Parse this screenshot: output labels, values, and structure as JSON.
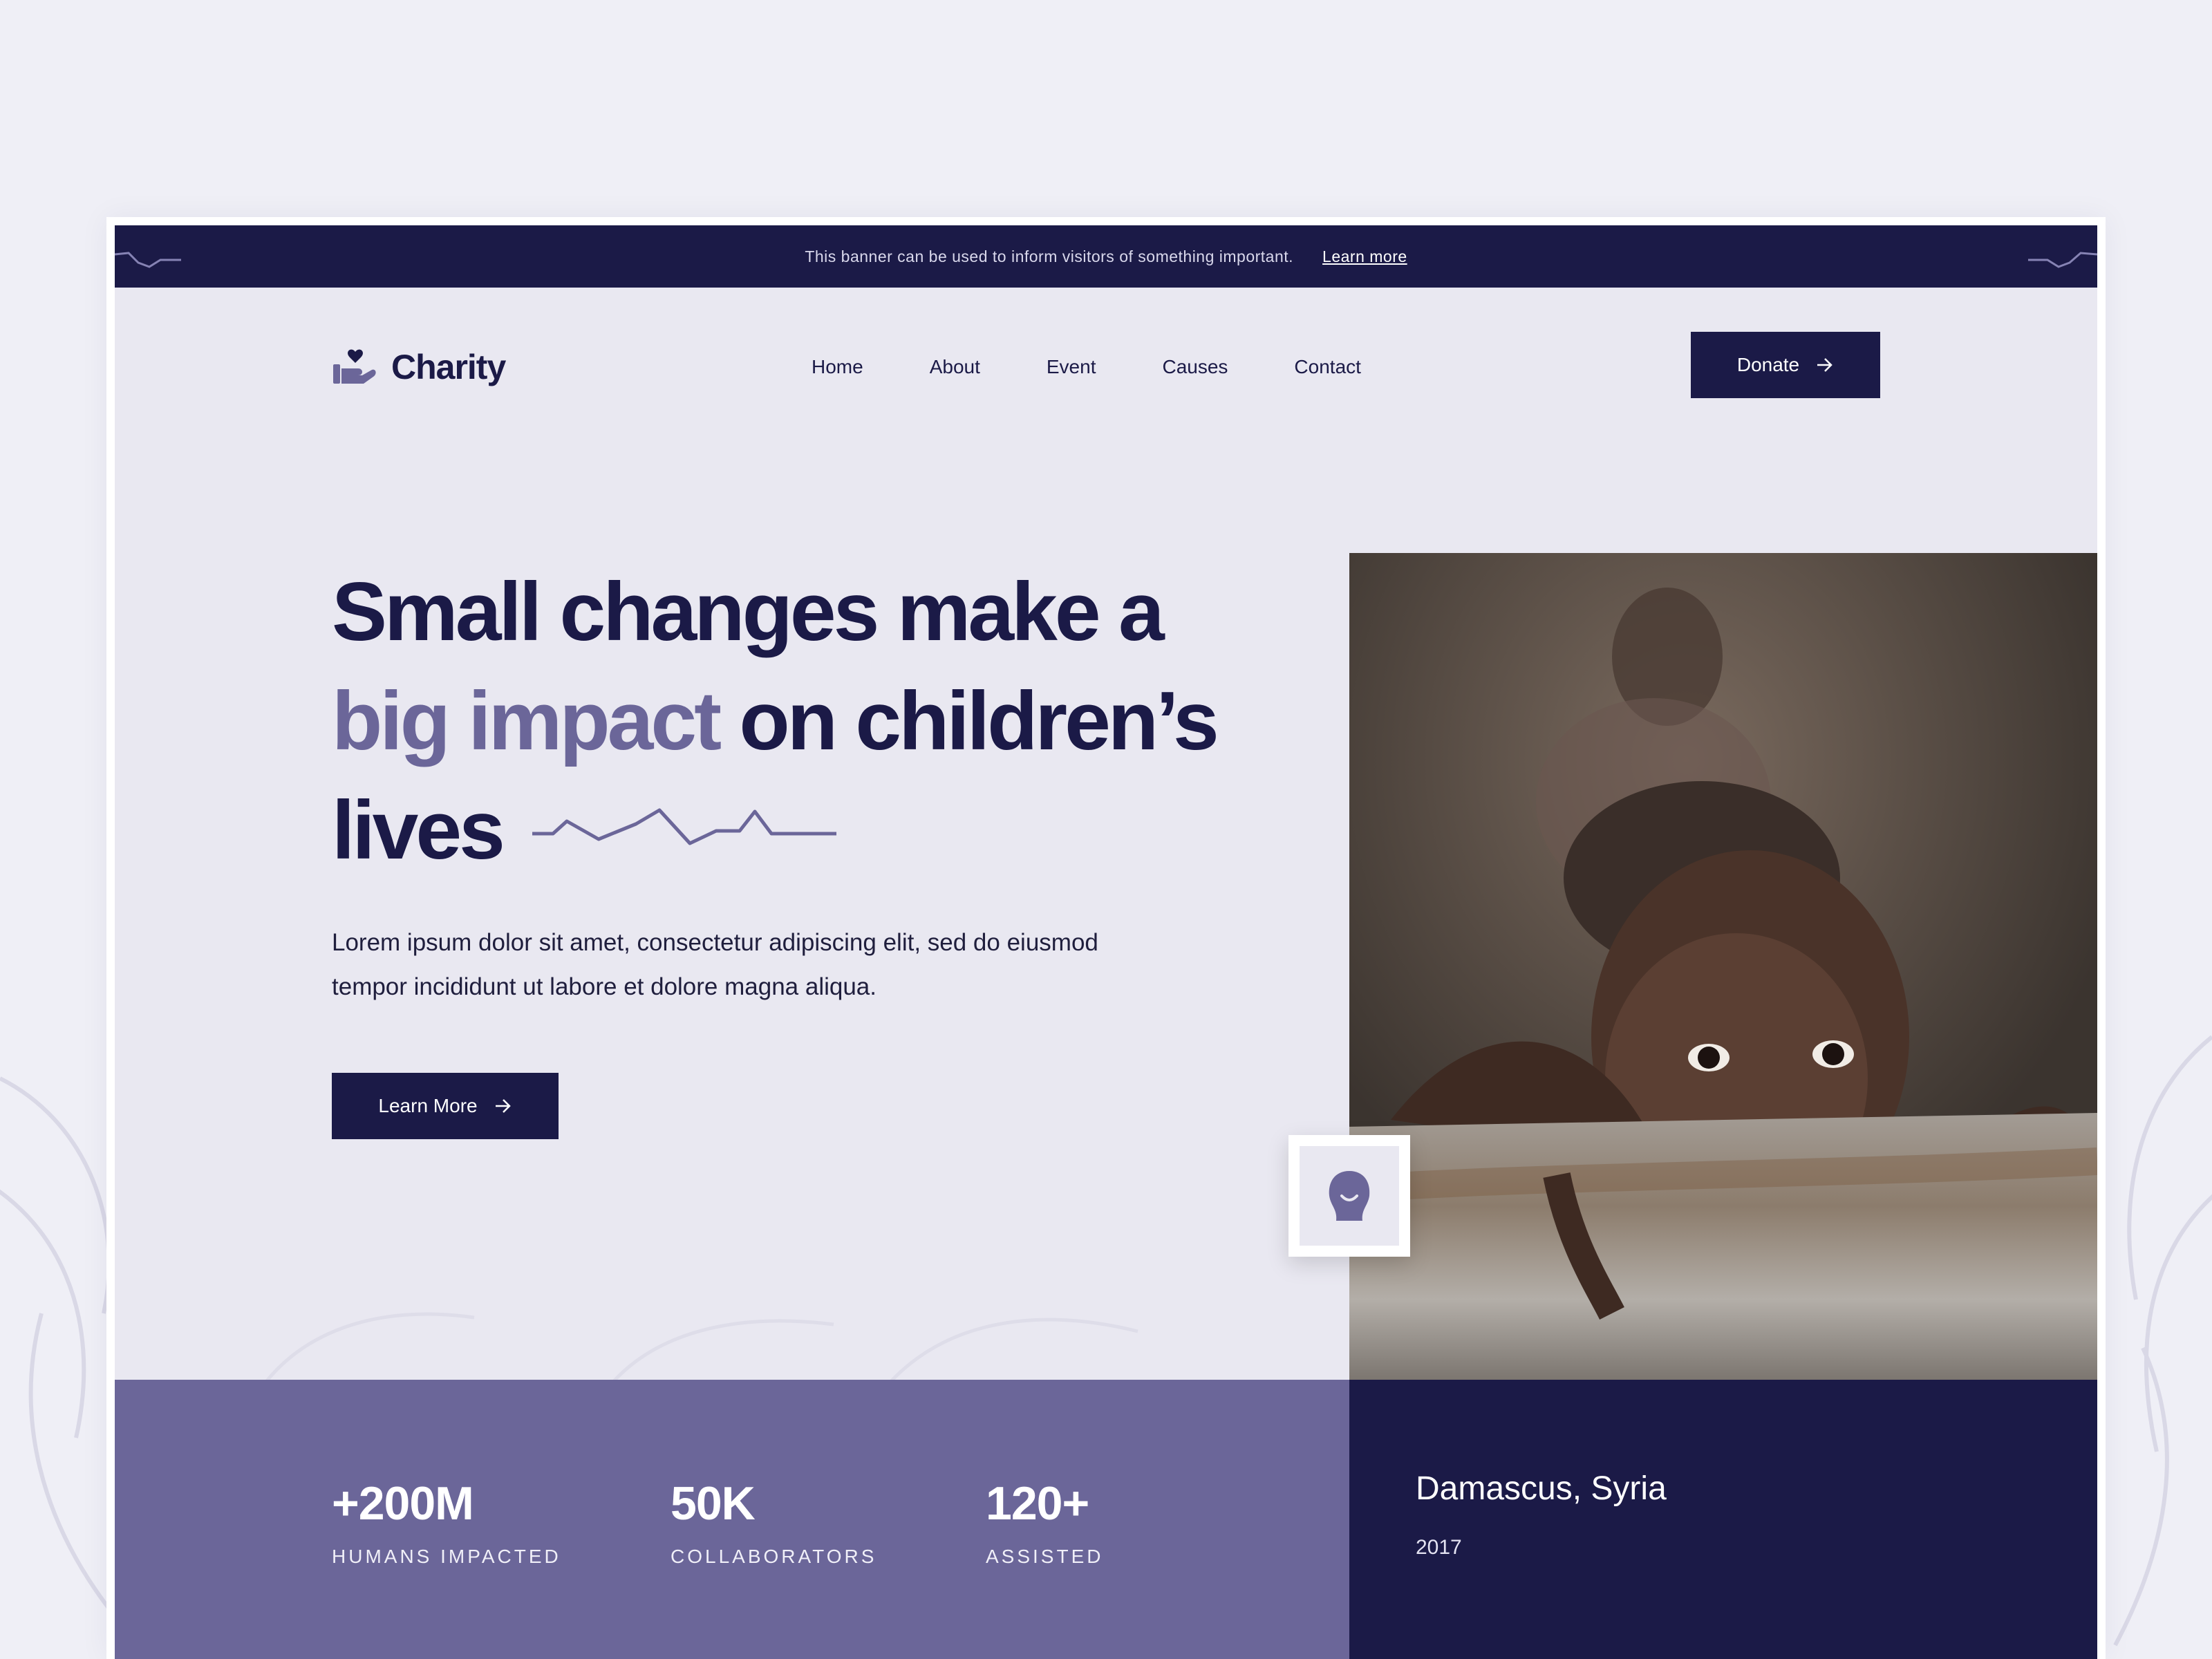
{
  "banner": {
    "message": "This banner can be used to inform visitors of something important.",
    "link_label": "Learn more"
  },
  "brand": {
    "name": "Charity"
  },
  "nav": {
    "items": [
      {
        "label": "Home"
      },
      {
        "label": "About"
      },
      {
        "label": "Event"
      },
      {
        "label": "Causes"
      },
      {
        "label": "Contact"
      }
    ],
    "donate_label": "Donate"
  },
  "hero": {
    "headline_part1": "Small changes make a",
    "headline_highlight": "big impact",
    "headline_part2": " on children’s",
    "headline_part3": "lives",
    "lead": "Lorem ipsum dolor sit amet, consectetur adipiscing elit, sed do eiusmod tempor incididunt ut labore et dolore magna aliqua.",
    "cta_label": "Learn More"
  },
  "stats": [
    {
      "value": "+200M",
      "label": "HUMANS IMPACTED"
    },
    {
      "value": "50K",
      "label": "COLLABORATORS"
    },
    {
      "value": "120+",
      "label": "ASSISTED"
    }
  ],
  "location": {
    "name": "Damascus, Syria",
    "year": "2017"
  },
  "icons": {
    "logo": "hand-heart-icon",
    "arrow": "arrow-right-icon",
    "badge": "person-icon"
  },
  "colors": {
    "navy": "#1b1a47",
    "lavender": "#6b6699",
    "page_bg": "#e9e8f1"
  }
}
